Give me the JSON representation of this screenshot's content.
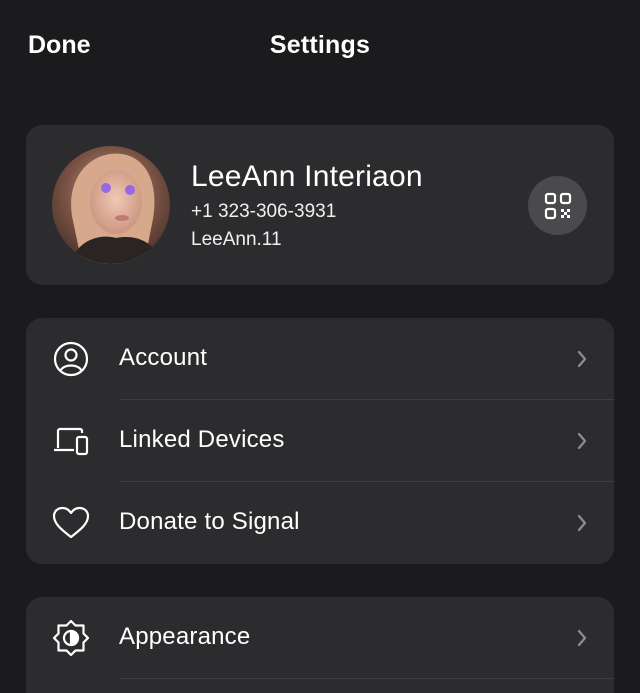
{
  "header": {
    "done_label": "Done",
    "title": "Settings"
  },
  "profile": {
    "name": "LeeAnn Interiaon",
    "phone": "+1 323-306-3931",
    "username": "LeeAnn.11",
    "qr_icon": "qr-code-icon"
  },
  "menu_group_1": {
    "items": [
      {
        "label": "Account",
        "icon": "person-circle-icon"
      },
      {
        "label": "Linked Devices",
        "icon": "devices-icon"
      },
      {
        "label": "Donate to Signal",
        "icon": "heart-icon"
      }
    ]
  },
  "menu_group_2": {
    "items": [
      {
        "label": "Appearance",
        "icon": "appearance-icon"
      }
    ]
  },
  "colors": {
    "background": "#1b1b1d",
    "card": "#2c2c2e",
    "qr_button": "#4a4a4d",
    "chevron": "#8e8e93",
    "divider": "#3d3d40"
  }
}
